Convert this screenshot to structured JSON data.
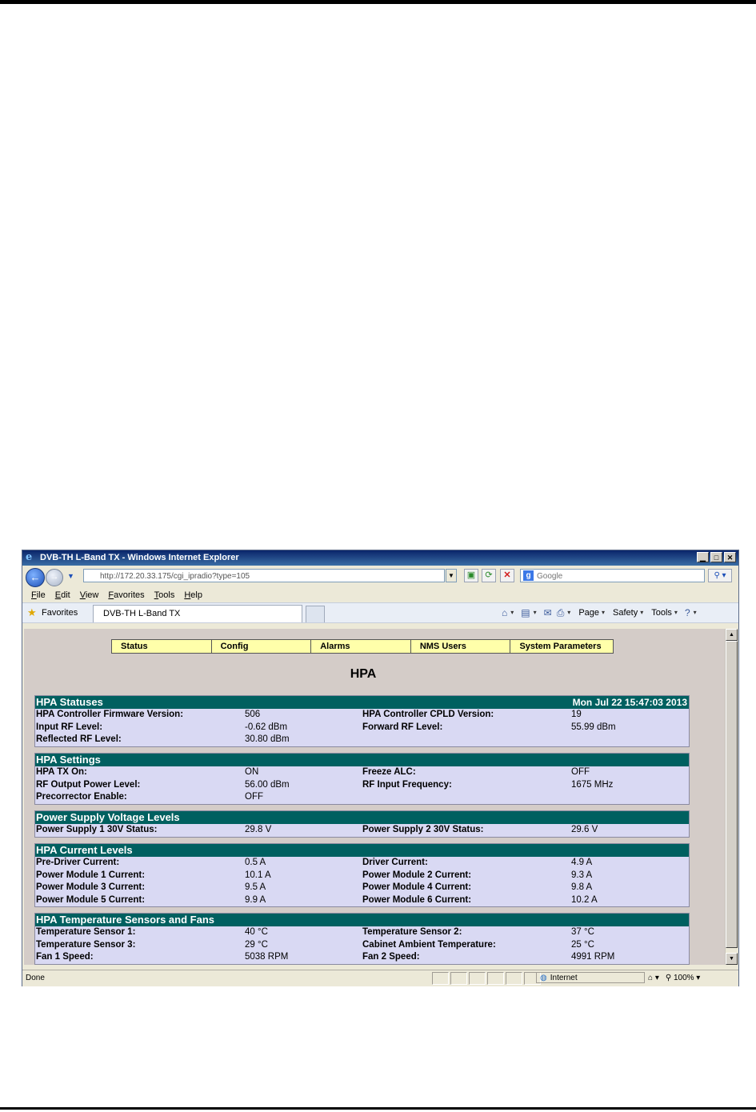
{
  "browser": {
    "title": "DVB-TH L-Band TX - Windows Internet Explorer",
    "url": "http://172.20.33.175/cgi_ipradio?type=105",
    "search_placeholder": "Google",
    "menu": [
      "File",
      "Edit",
      "View",
      "Favorites",
      "Tools",
      "Help"
    ],
    "favorites_label": "Favorites",
    "tab_title": "DVB-TH L-Band TX",
    "commands": [
      "Page",
      "Safety",
      "Tools"
    ],
    "status_text": "Done",
    "zone": "Internet",
    "zoom": "100%"
  },
  "nav": [
    "Status",
    "Config",
    "Alarms",
    "NMS Users",
    "System Parameters"
  ],
  "page_title": "HPA",
  "sections": {
    "statuses": {
      "title": "HPA Statuses",
      "timestamp": "Mon Jul 22 15:47:03 2013",
      "rows": [
        [
          "HPA Controller Firmware Version:",
          "506",
          "HPA Controller CPLD Version:",
          "19"
        ],
        [
          "Input RF Level:",
          "-0.62 dBm",
          "Forward RF Level:",
          "55.99 dBm"
        ],
        [
          "Reflected RF Level:",
          "30.80 dBm",
          "",
          ""
        ]
      ]
    },
    "settings": {
      "title": "HPA Settings",
      "rows": [
        [
          "HPA TX On:",
          "ON",
          "Freeze ALC:",
          "OFF"
        ],
        [
          "RF Output Power Level:",
          "56.00 dBm",
          "RF Input Frequency:",
          "1675 MHz"
        ],
        [
          "Precorrector Enable:",
          "OFF",
          "",
          ""
        ]
      ]
    },
    "power": {
      "title": "Power Supply Voltage Levels",
      "rows": [
        [
          "Power Supply 1 30V Status:",
          "29.8 V",
          "Power Supply 2 30V Status:",
          "29.6 V"
        ]
      ]
    },
    "current": {
      "title": "HPA Current Levels",
      "rows": [
        [
          "Pre-Driver Current:",
          "0.5 A",
          "Driver Current:",
          "4.9 A"
        ],
        [
          "Power Module 1 Current:",
          "10.1 A",
          "Power Module 2 Current:",
          "9.3 A"
        ],
        [
          "Power Module 3 Current:",
          "9.5 A",
          "Power Module 4 Current:",
          "9.8 A"
        ],
        [
          "Power Module 5 Current:",
          "9.9 A",
          "Power Module 6 Current:",
          "10.2 A"
        ]
      ]
    },
    "temps": {
      "title": "HPA Temperature Sensors and Fans",
      "rows": [
        [
          "Temperature Sensor 1:",
          "40 °C",
          "Temperature Sensor 2:",
          "37 °C"
        ],
        [
          "Temperature Sensor 3:",
          "29 °C",
          "Cabinet Ambient Temperature:",
          "25 °C"
        ],
        [
          "Fan 1 Speed:",
          "5038 RPM",
          "Fan 2 Speed:",
          "4991 RPM"
        ]
      ]
    }
  }
}
